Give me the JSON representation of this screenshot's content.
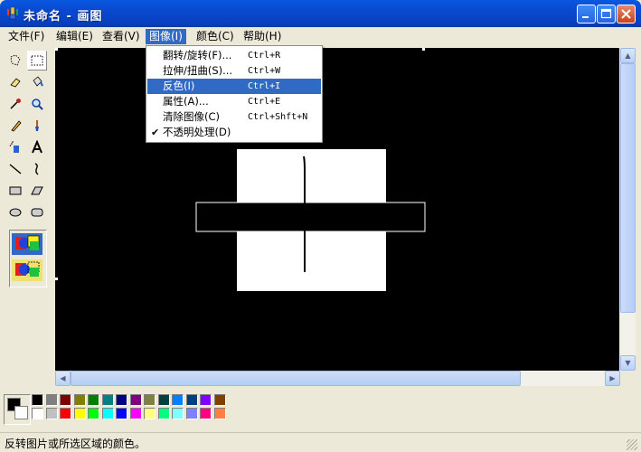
{
  "window": {
    "title": "未命名 - 画图"
  },
  "menubar": {
    "items": [
      {
        "label": "文件(F)"
      },
      {
        "label": "编辑(E)"
      },
      {
        "label": "查看(V)"
      },
      {
        "label": "图像(I)"
      },
      {
        "label": "颜色(C)"
      },
      {
        "label": "帮助(H)"
      }
    ]
  },
  "image_menu": {
    "items": [
      {
        "label": "翻转/旋转(F)...",
        "shortcut": "Ctrl+R"
      },
      {
        "label": "拉伸/扭曲(S)...",
        "shortcut": "Ctrl+W"
      },
      {
        "label": "反色(I)",
        "shortcut": "Ctrl+I"
      },
      {
        "label": "属性(A)...",
        "shortcut": "Ctrl+E"
      },
      {
        "label": "清除图像(C)",
        "shortcut": "Ctrl+Shft+N"
      },
      {
        "label": "不透明处理(D)",
        "shortcut": "",
        "check": "✔"
      }
    ]
  },
  "toolbox": {
    "tools": [
      "free-select",
      "rect-select",
      "eraser",
      "fill",
      "color-picker",
      "magnifier",
      "pencil",
      "brush",
      "airbrush",
      "text",
      "line",
      "curve",
      "rectangle",
      "polygon",
      "ellipse",
      "rounded-rect"
    ]
  },
  "palette": {
    "foreground": "#000000",
    "background": "#ffffff",
    "row1": [
      "#000000",
      "#808080",
      "#800000",
      "#808000",
      "#008000",
      "#008080",
      "#000080",
      "#800080",
      "#808040",
      "#004040",
      "#0080ff",
      "#004080",
      "#8000ff",
      "#804000"
    ],
    "row2": [
      "#ffffff",
      "#c0c0c0",
      "#ff0000",
      "#ffff00",
      "#00ff00",
      "#00ffff",
      "#0000ff",
      "#ff00ff",
      "#ffff80",
      "#00ff80",
      "#80ffff",
      "#8080ff",
      "#ff0080",
      "#ff8040"
    ]
  },
  "status": {
    "text": "反转图片或所选区域的颜色。"
  }
}
